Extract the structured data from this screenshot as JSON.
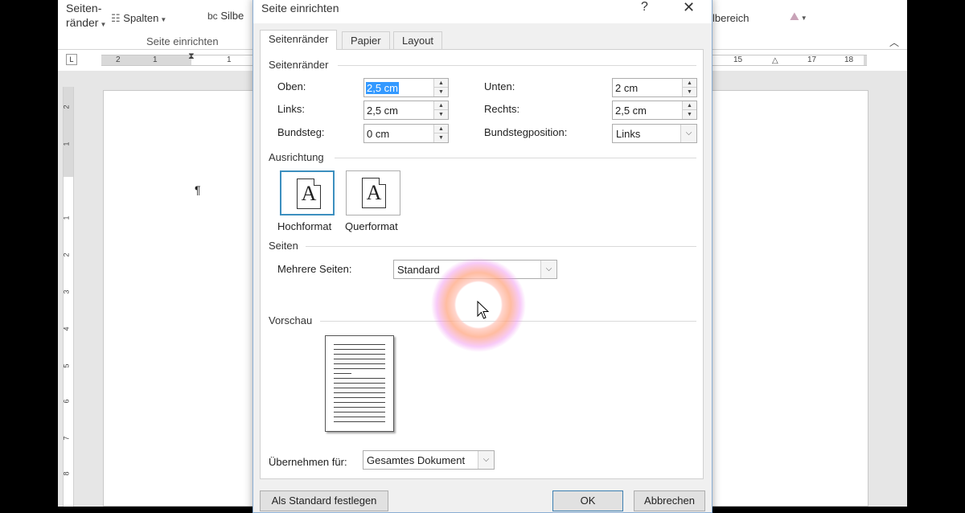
{
  "ribbon": {
    "margins_label_1": "Seiten-",
    "margins_label_2": "ränder",
    "columns_label": "Spalten",
    "hyphen_label": "Silbe",
    "hyphen_icon_text": "bc",
    "area_label": "lbereich",
    "group_label": "Seite einrichten"
  },
  "ruler": {
    "tab_selector": "L",
    "left_ticks": [
      "2",
      "1",
      "1"
    ],
    "right_ticks": [
      "15",
      "17",
      "18"
    ],
    "vertical_ticks": [
      "2",
      "1",
      "1",
      "2",
      "3",
      "4",
      "5",
      "6",
      "7",
      "8"
    ]
  },
  "document": {
    "paragraph_mark": "¶"
  },
  "dialog": {
    "title": "Seite einrichten",
    "help": "?",
    "close": "✕",
    "tabs": [
      "Seitenränder",
      "Papier",
      "Layout"
    ],
    "margins_section": "Seitenränder",
    "fields": {
      "top": {
        "label": "Oben:",
        "value": "2,5 cm"
      },
      "bottom": {
        "label": "Unten:",
        "value": "2 cm"
      },
      "left": {
        "label": "Links:",
        "value": "2,5 cm"
      },
      "right": {
        "label": "Rechts:",
        "value": "2,5 cm"
      },
      "gutter": {
        "label": "Bundsteg:",
        "value": "0 cm"
      },
      "gutter_position": {
        "label": "Bundstegposition:",
        "value": "Links"
      }
    },
    "orientation_section": "Ausrichtung",
    "portrait": "Hochformat",
    "landscape": "Querformat",
    "orientation_glyph": "A",
    "pages_section": "Seiten",
    "multiple_pages": {
      "label": "Mehrere Seiten:",
      "value": "Standard"
    },
    "preview_section": "Vorschau",
    "apply_to": {
      "label": "Übernehmen für:",
      "value": "Gesamtes Dokument"
    },
    "set_default_button": "Als Standard festlegen",
    "ok_button": "OK",
    "cancel_button": "Abbrechen"
  }
}
